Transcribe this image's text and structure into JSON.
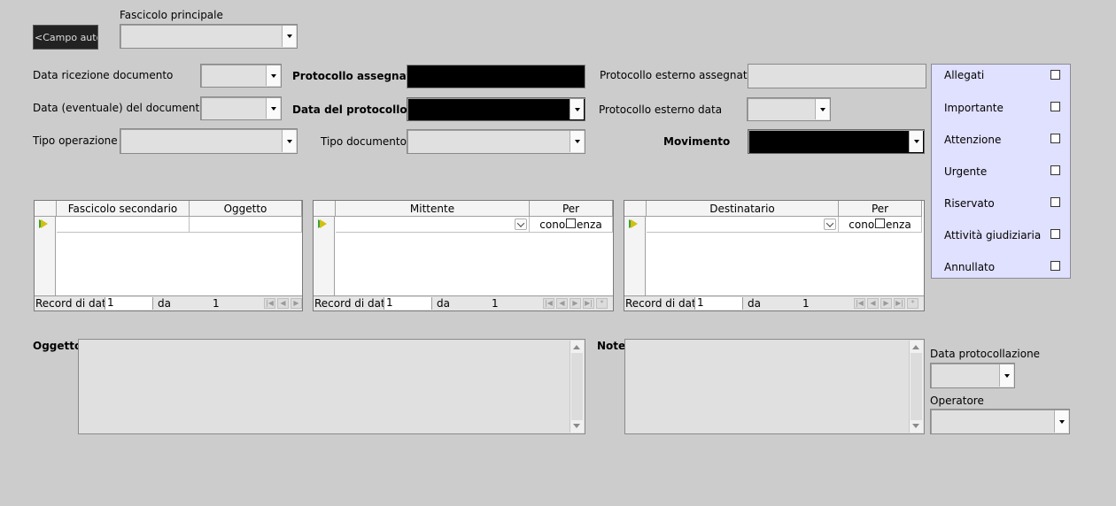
{
  "top": {
    "auto_field_label": "<Campo auto",
    "fascicolo_principale_label": "Fascicolo principale"
  },
  "fields": {
    "data_ricezione_label": "Data ricezione documento",
    "data_eventuale_label": "Data (eventuale) del documento",
    "tipo_operazione_label": "Tipo operazione",
    "protocollo_assegnato_label": "Protocollo assegnato",
    "data_protocollo_label": "Data del protocollo",
    "tipo_documento_label": "Tipo documento",
    "protocollo_esterno_label": "Protocollo esterno assegnato",
    "protocollo_esterno_data_label": "Protocollo esterno data",
    "movimento_label": "Movimento"
  },
  "flags": [
    {
      "label": "Allegati",
      "checked": false
    },
    {
      "label": "Importante",
      "checked": false
    },
    {
      "label": "Attenzione",
      "checked": false
    },
    {
      "label": "Urgente",
      "checked": false
    },
    {
      "label": "Riservato",
      "checked": false
    },
    {
      "label": "Attività giudiziaria",
      "checked": false
    },
    {
      "label": "Annullato",
      "checked": false
    }
  ],
  "grids": {
    "fascicoli": {
      "columns": [
        "Fascicolo secondario",
        "Oggetto"
      ],
      "nav": {
        "record_label": "Record di dati",
        "record": "1",
        "da_label": "da",
        "total": "1"
      }
    },
    "mittenti": {
      "columns": [
        "Mittente",
        "Per conoscenza"
      ],
      "nav": {
        "record_label": "Record di dati",
        "record": "1",
        "da_label": "da",
        "total": "1"
      }
    },
    "destinatari": {
      "columns": [
        "Destinatario",
        "Per conoscenza"
      ],
      "nav": {
        "record_label": "Record di dati",
        "record": "1",
        "da_label": "da",
        "total": "1"
      }
    }
  },
  "bottom": {
    "oggetto_label": "Oggetto",
    "note_label": "Note",
    "data_protocollazione_label": "Data protocollazione",
    "operatore_label": "Operatore"
  }
}
